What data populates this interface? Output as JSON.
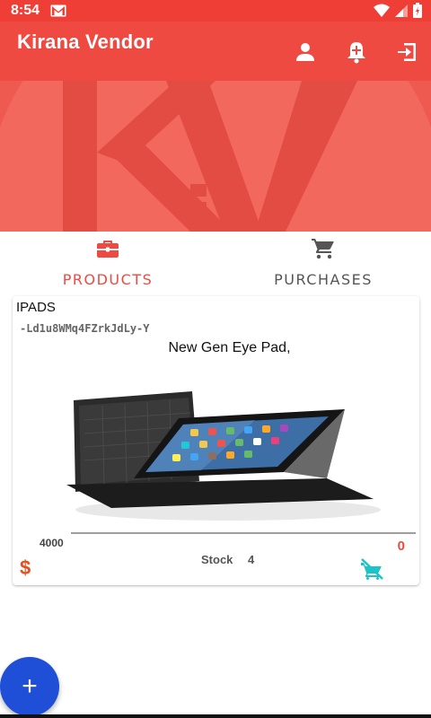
{
  "status_bar": {
    "time": "8:54"
  },
  "app": {
    "title": "Kirana Vendor"
  },
  "banner": {
    "logo_text": "KiV"
  },
  "tabs": [
    {
      "label": "PRODUCTS",
      "icon": "briefcase-icon",
      "active": true
    },
    {
      "label": "PURCHASES",
      "icon": "cart-icon",
      "active": false
    }
  ],
  "product": {
    "category": "IPADS",
    "id": "-Ld1u8WMq4FZrkJdLy-Y",
    "description": "New Gen Eye Pad,",
    "price": "4000",
    "cart_count": "0",
    "stock_label": "Stock",
    "stock_value": "4"
  },
  "fab": {
    "label": "+"
  },
  "colors": {
    "primary": "#ee4a42",
    "status_bar": "#ee3e36",
    "banner": "#ef5a50",
    "fab": "#1f4fd6",
    "accent_teal": "#1cc4c9"
  }
}
